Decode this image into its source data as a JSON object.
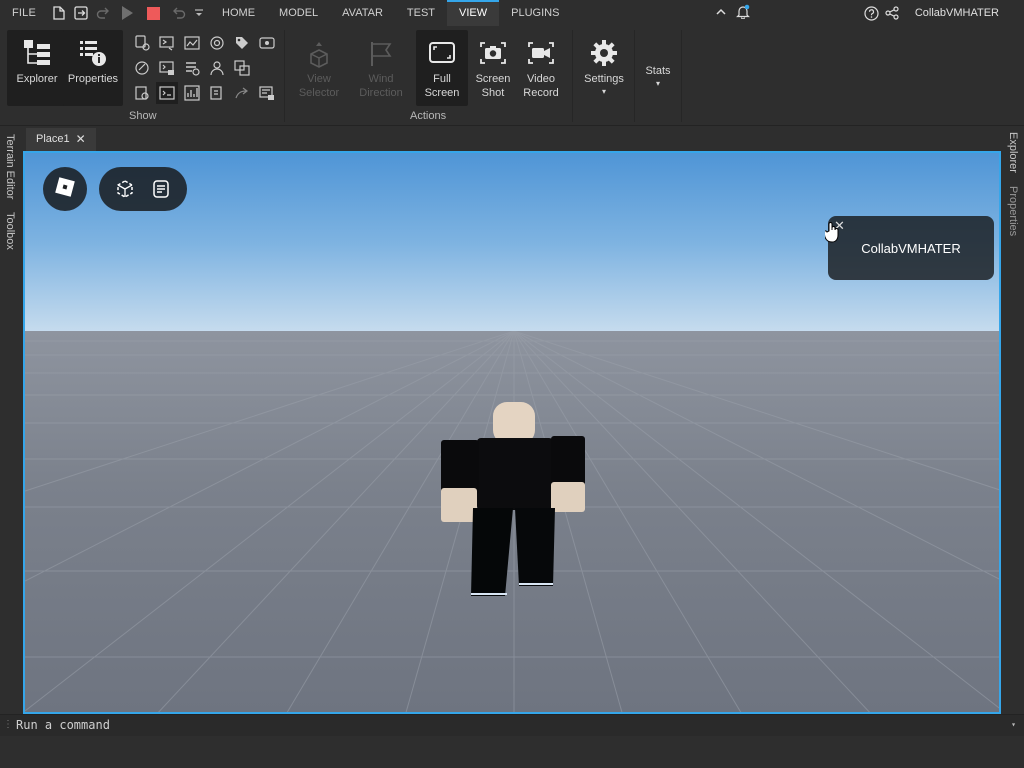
{
  "menubar": {
    "file": "FILE",
    "tabs": [
      "HOME",
      "MODEL",
      "AVATAR",
      "TEST",
      "VIEW",
      "PLUGINS"
    ],
    "active_tab": "VIEW",
    "username": "CollabVMHATER"
  },
  "ribbon": {
    "explorer": "Explorer",
    "properties": "Properties",
    "show_group": "Show",
    "view_selector_1": "View",
    "view_selector_2": "Selector",
    "wind_direction_1": "Wind",
    "wind_direction_2": "Direction",
    "full_screen_1": "Full",
    "full_screen_2": "Screen",
    "screen_shot_1": "Screen",
    "screen_shot_2": "Shot",
    "video_record_1": "Video",
    "video_record_2": "Record",
    "actions_group": "Actions",
    "settings": "Settings",
    "stats": "Stats"
  },
  "docks": {
    "terrain_editor": "Terrain Editor",
    "toolbox": "Toolbox",
    "explorer": "Explorer",
    "properties": "Properties"
  },
  "document_tab": {
    "label": "Place1"
  },
  "viewport": {
    "toast_text": "CollabVMHATER"
  },
  "command_bar": {
    "placeholder": "Run a command"
  },
  "colors": {
    "accent": "#35a6ea",
    "stop": "#e74c3c",
    "background": "#2e2e2e"
  }
}
